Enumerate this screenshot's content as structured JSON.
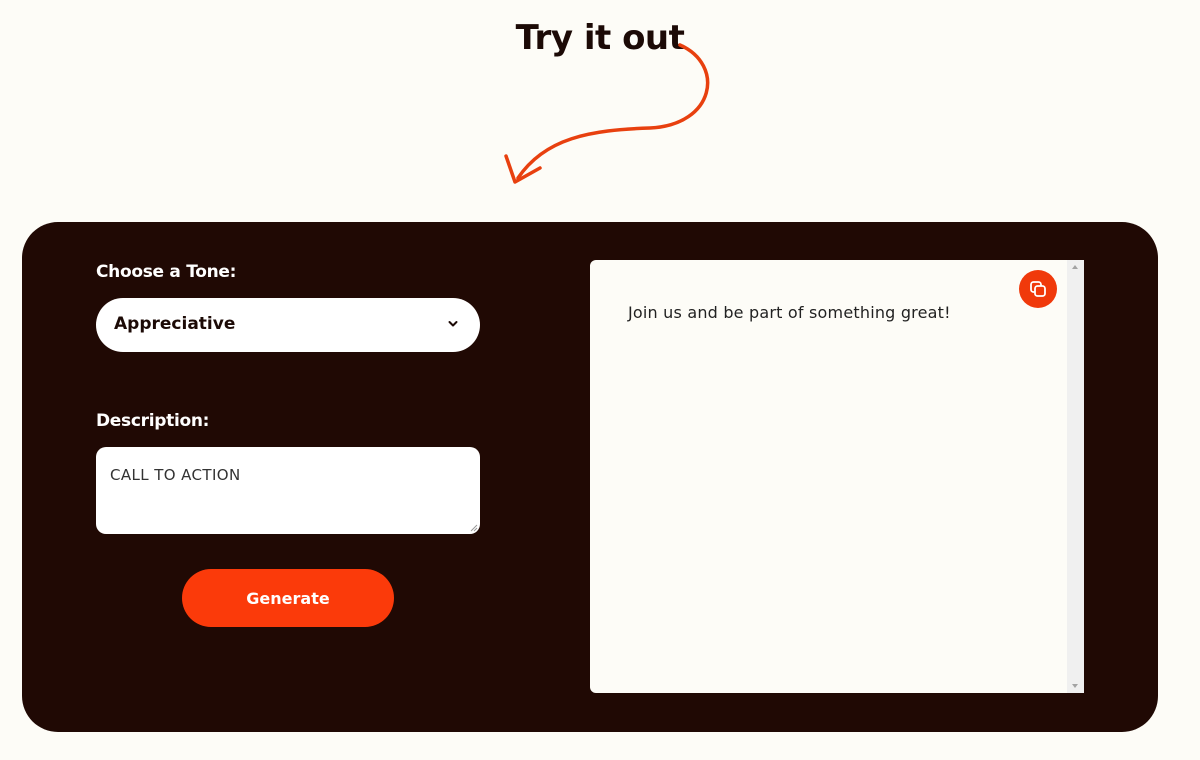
{
  "heading": "Try it out",
  "form": {
    "tone_label": "Choose a Tone:",
    "tone_value": "Appreciative",
    "description_label": "Description:",
    "description_value": "CALL TO ACTION",
    "generate_label": "Generate"
  },
  "output": {
    "text": "Join us and be part of something great!"
  },
  "colors": {
    "accent": "#fb3a0a",
    "panel": "#200904",
    "page_background": "#fdfcf7"
  },
  "icons": {
    "arrow": "curved-arrow-icon",
    "dropdown": "chevron-down-icon",
    "copy": "copy-icon"
  }
}
